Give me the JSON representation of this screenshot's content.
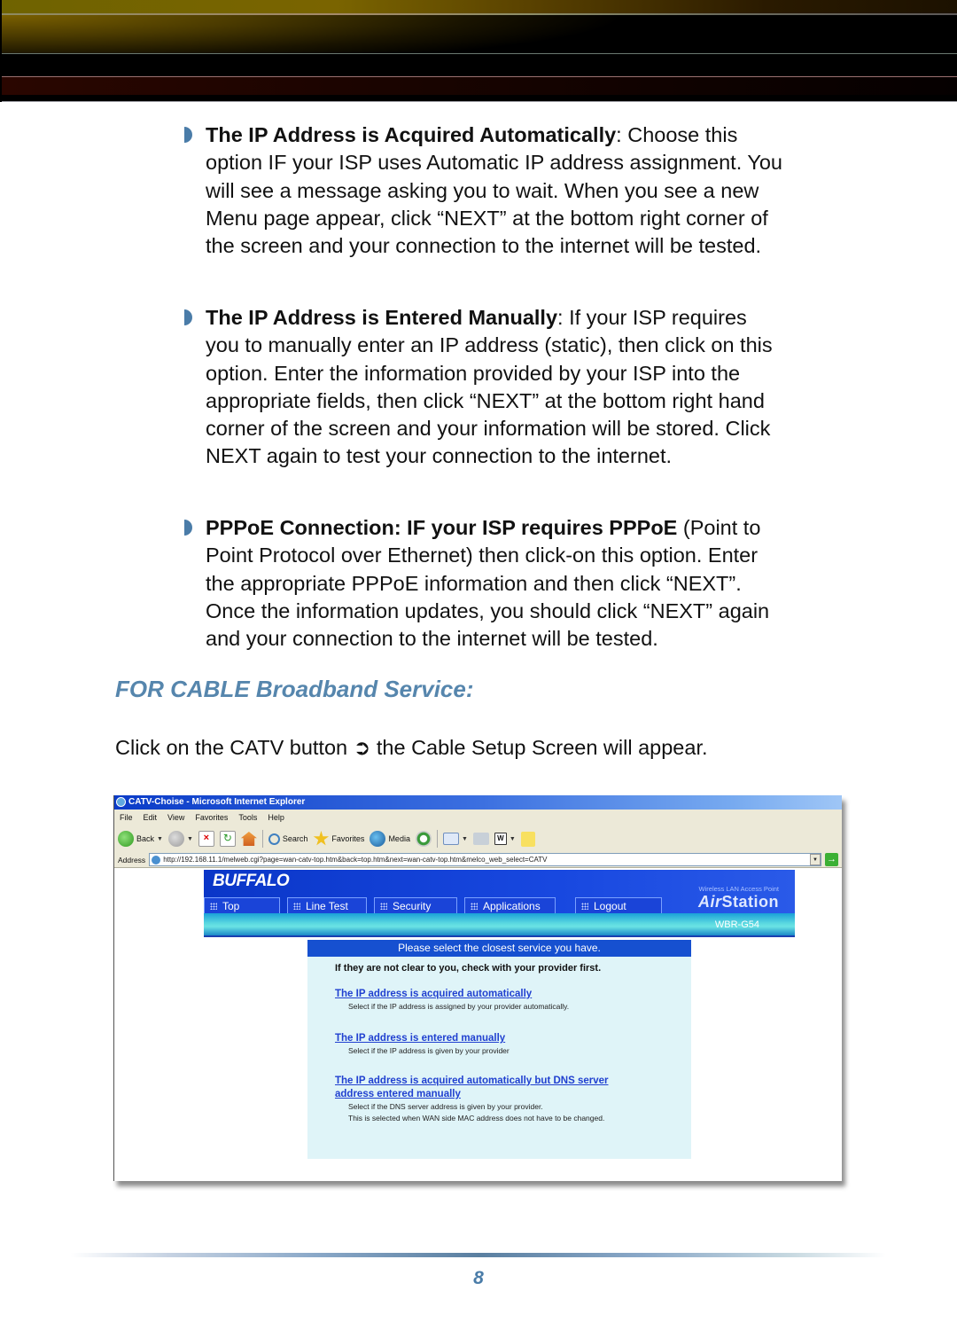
{
  "bullets": [
    {
      "heading": "The IP Address is Acquired Automatically",
      "lines": [
        ":  Choose this",
        "option IF your ISP uses Automatic IP address assignment.  You",
        "will see a message asking you to wait. When you see a new",
        "Menu page appear, click “NEXT” at the bottom right corner of",
        "the screen and your connection to the internet will be tested."
      ]
    },
    {
      "heading": "The IP Address is Entered Manually",
      "lines": [
        ":  If your ISP requires",
        "you to manually enter an IP address (static), then click on this",
        "option.  Enter the information provided by your ISP into the",
        "appropriate fields, then click “NEXT” at the bottom right hand",
        "corner of the screen and your information will be stored.  Click",
        "NEXT again to test your connection to the internet."
      ]
    },
    {
      "heading": "PPPoE Connection: IF your ISP requires PPPoE",
      "lines": [
        " (Point to",
        "Point Protocol over Ethernet)  then click-on this option.  Enter",
        "the appropriate PPPoE information and then click “NEXT”.",
        "Once the information updates, you should click “NEXT” again",
        "and your connection to the internet will be tested."
      ]
    }
  ],
  "section_title": "FOR CABLE Broadband Service:",
  "intro": {
    "before": "Click on the CATV button ",
    "arrow": "➲",
    "after": " the Cable Setup Screen will appear."
  },
  "browser": {
    "title": "CATV-Choise - Microsoft Internet Explorer",
    "menu": [
      "File",
      "Edit",
      "View",
      "Favorites",
      "Tools",
      "Help"
    ],
    "toolbar": {
      "back": "Back",
      "search": "Search",
      "favorites": "Favorites",
      "media": "Media"
    },
    "address_label": "Address",
    "address_value": "http://192.168.11.1/melweb.cgi?page=wan-catv-top.htm&back=top.htm&next=wan-catv-top.htm&melco_web_select=CATV"
  },
  "router_page": {
    "logo": "BUFFALO",
    "subtitle": "Wireless LAN Access Point",
    "brand_a": "Air",
    "brand_b": "Station",
    "model": "WBR-G54",
    "tabs": [
      "Top",
      "Line Test",
      "Security",
      "Applications",
      "Logout"
    ],
    "panel_heading": "Please select the closest service you have.",
    "note": "If they are not clear to you, check with your provider first.",
    "options": [
      {
        "link": "The IP address is acquired automatically",
        "desc": [
          "Select if the IP address is assigned by your provider automatically."
        ]
      },
      {
        "link": "The IP address is entered manually",
        "desc": [
          "Select if the IP address is given by your provider"
        ]
      },
      {
        "link": "The IP address is acquired automatically but DNS server address entered manually",
        "desc": [
          "Select if the DNS server address is given by your provider.",
          "This is selected when WAN side MAC address does not have to be changed."
        ]
      }
    ]
  },
  "page_number": "8"
}
